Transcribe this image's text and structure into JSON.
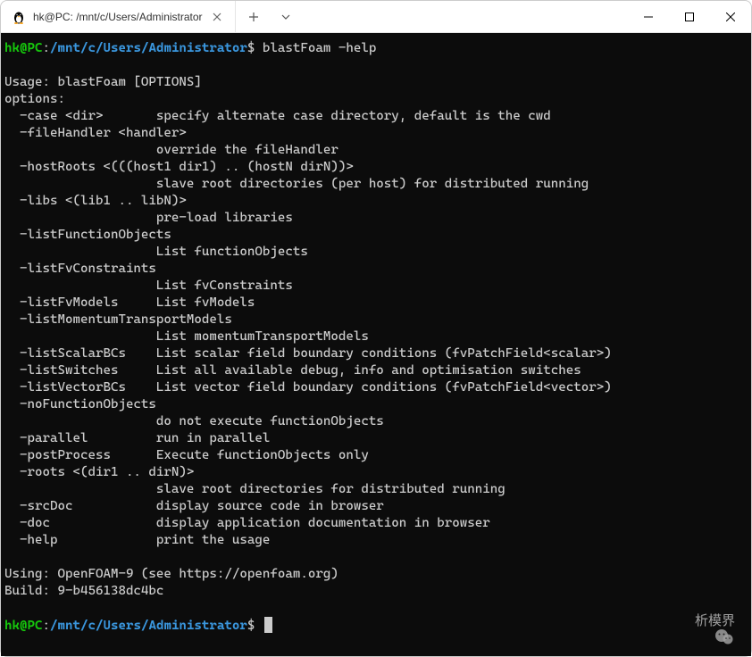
{
  "window": {
    "tab_title": "hk@PC: /mnt/c/Users/Administrator"
  },
  "prompt": {
    "user": "hk",
    "at": "@",
    "host": "PC",
    "colon": ":",
    "path": "/mnt/c/Users/Administrator",
    "dollar": "$"
  },
  "command1": " blastFoam -help",
  "output": "\nUsage: blastFoam [OPTIONS]\noptions:\n  -case <dir>       specify alternate case directory, default is the cwd\n  -fileHandler <handler>\n                    override the fileHandler\n  -hostRoots <(((host1 dir1) .. (hostN dirN))>\n                    slave root directories (per host) for distributed running\n  -libs <(lib1 .. libN)>\n                    pre-load libraries\n  -listFunctionObjects\n                    List functionObjects\n  -listFvConstraints\n                    List fvConstraints\n  -listFvModels     List fvModels\n  -listMomentumTransportModels\n                    List momentumTransportModels\n  -listScalarBCs    List scalar field boundary conditions (fvPatchField<scalar>)\n  -listSwitches     List all available debug, info and optimisation switches\n  -listVectorBCs    List vector field boundary conditions (fvPatchField<vector>)\n  -noFunctionObjects\n                    do not execute functionObjects\n  -parallel         run in parallel\n  -postProcess      Execute functionObjects only\n  -roots <(dir1 .. dirN)>\n                    slave root directories for distributed running\n  -srcDoc           display source code in browser\n  -doc              display application documentation in browser\n  -help             print the usage\n\nUsing: OpenFOAM-9 (see https://openfoam.org)\nBuild: 9-b456138dc4bc\n",
  "command2": " ",
  "watermark": "析模界"
}
